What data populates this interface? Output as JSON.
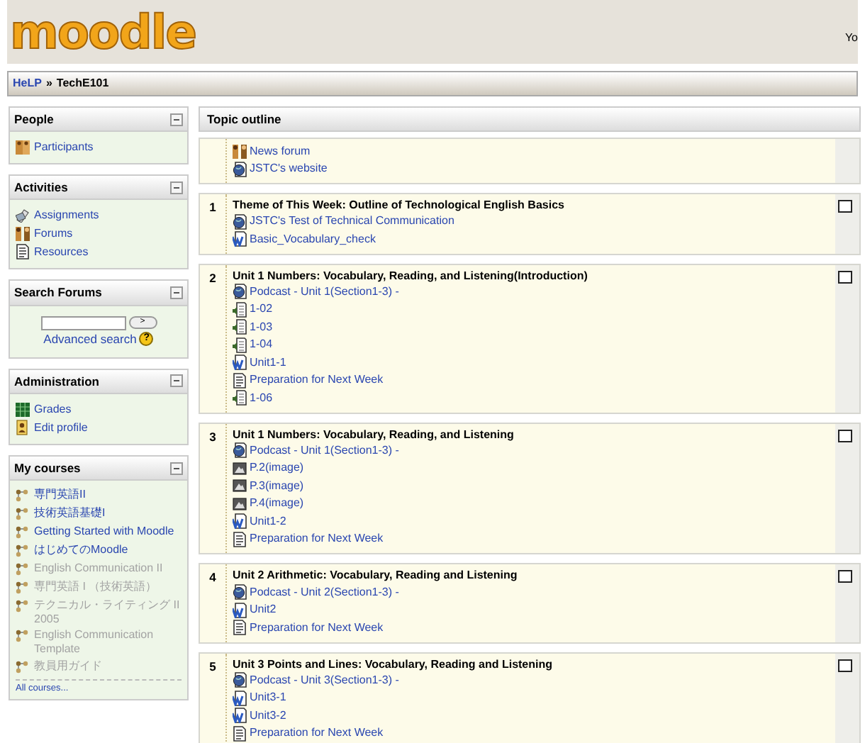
{
  "header": {
    "logo": "moodle",
    "login_text": "Yo"
  },
  "breadcrumb": [
    {
      "label": "HeLP",
      "link": true
    },
    {
      "label": "»",
      "link": false
    },
    {
      "label": "TechE101",
      "link": false
    }
  ],
  "blocks": [
    {
      "title": "People",
      "kind": "list",
      "items": [
        {
          "label": "Participants",
          "kind": "people"
        }
      ]
    },
    {
      "title": "Activities",
      "kind": "list",
      "items": [
        {
          "label": "Assignments",
          "kind": "assignment"
        },
        {
          "label": "Forums",
          "kind": "forum"
        },
        {
          "label": "Resources",
          "kind": "text"
        }
      ]
    },
    {
      "title": "Search Forums",
      "kind": "search",
      "button": ">",
      "link": "Advanced search",
      "help": "?"
    },
    {
      "title": "Administration",
      "kind": "list",
      "items": [
        {
          "label": "Grades",
          "kind": "grades"
        },
        {
          "label": "Edit profile",
          "kind": "profile"
        }
      ]
    },
    {
      "title": "My courses",
      "kind": "courses",
      "items": [
        {
          "label": "専門英語II",
          "hidden": false
        },
        {
          "label": "技術英語基礎I",
          "hidden": false
        },
        {
          "label": "Getting Started with Moodle",
          "hidden": false
        },
        {
          "label": "はじめてのMoodle",
          "hidden": false
        },
        {
          "label": "English Communication II",
          "hidden": true
        },
        {
          "label": "専門英語 I （技術英語）",
          "hidden": true
        },
        {
          "label": "テクニカル・ライティング II 2005",
          "hidden": true
        },
        {
          "label": "English Communication Template",
          "hidden": true
        },
        {
          "label": "教員用ガイド",
          "hidden": true
        }
      ],
      "more": "All courses..."
    }
  ],
  "topic_outline": {
    "title": "Topic outline",
    "sections": [
      {
        "items": [
          {
            "label": "News forum",
            "kind": "forum"
          },
          {
            "label": "JSTC's website",
            "kind": "web"
          }
        ]
      },
      {
        "number": "1",
        "title": "Theme of This Week: Outline of Technological English Basics",
        "highlighted": false,
        "items": [
          {
            "label": "JSTC's Test of Technical Communication",
            "kind": "web"
          },
          {
            "label": "Basic_Vocabulary_check",
            "kind": "word"
          }
        ]
      },
      {
        "number": "2",
        "title": "Unit 1 Numbers: Vocabulary, Reading, and Listening(Introduction)",
        "highlighted": false,
        "items": [
          {
            "label": "Podcast - Unit 1(Section1-3) -",
            "kind": "web"
          },
          {
            "label": "1-02",
            "kind": "sound"
          },
          {
            "label": "1-03",
            "kind": "sound"
          },
          {
            "label": "1-04",
            "kind": "sound"
          },
          {
            "label": "Unit1-1",
            "kind": "word"
          },
          {
            "label": "Preparation for Next Week",
            "kind": "text"
          },
          {
            "label": "1-06",
            "kind": "sound"
          }
        ]
      },
      {
        "number": "3",
        "title": "Unit 1 Numbers: Vocabulary, Reading, and Listening",
        "highlighted": false,
        "items": [
          {
            "label": "Podcast - Unit 1(Section1-3) -",
            "kind": "web"
          },
          {
            "label": "P.2(image)",
            "kind": "image"
          },
          {
            "label": "P.3(image)",
            "kind": "image"
          },
          {
            "label": "P.4(image)",
            "kind": "image"
          },
          {
            "label": "Unit1-2",
            "kind": "word"
          },
          {
            "label": "Preparation for Next Week",
            "kind": "text"
          }
        ]
      },
      {
        "number": "4",
        "title": "Unit 2 Arithmetic: Vocabulary, Reading and Listening",
        "highlighted": false,
        "items": [
          {
            "label": "Podcast - Unit 2(Section1-3) -",
            "kind": "web"
          },
          {
            "label": "Unit2",
            "kind": "word"
          },
          {
            "label": "Preparation for Next Week",
            "kind": "text"
          }
        ]
      },
      {
        "number": "5",
        "title": "Unit 3 Points and Lines: Vocabulary, Reading and Listening",
        "highlighted": false,
        "items": [
          {
            "label": "Podcast - Unit 3(Section1-3) -",
            "kind": "web"
          },
          {
            "label": "Unit3-1",
            "kind": "word"
          },
          {
            "label": "Unit3-2",
            "kind": "word"
          },
          {
            "label": "Preparation for Next Week",
            "kind": "text"
          }
        ]
      }
    ]
  }
}
